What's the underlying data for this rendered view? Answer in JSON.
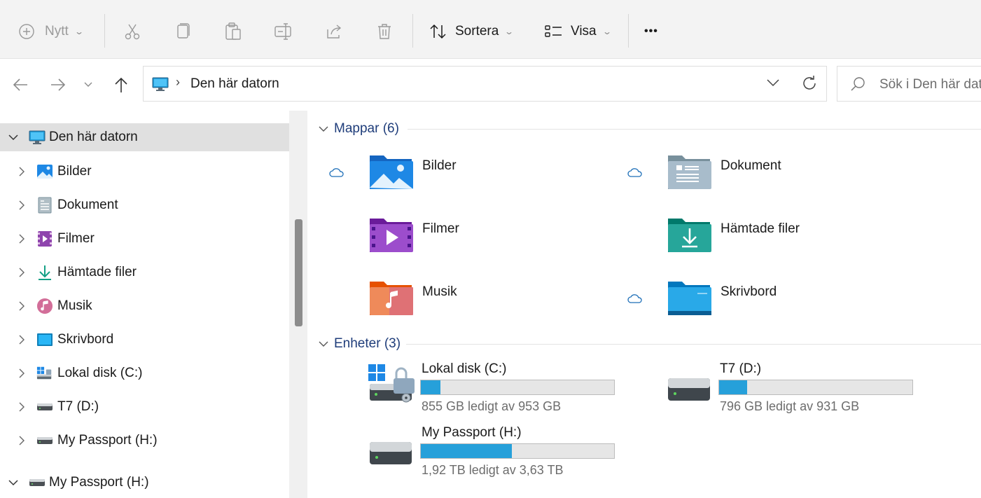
{
  "toolbar": {
    "new_label": "Nytt",
    "sort_label": "Sortera",
    "view_label": "Visa",
    "more_label": "•••"
  },
  "address": {
    "separator": "›",
    "current": "Den här datorn",
    "search_placeholder": "Sök i Den här datorn"
  },
  "sidebar": {
    "root": "Den här datorn",
    "items": [
      {
        "label": "Bilder",
        "icon": "pictures-icon"
      },
      {
        "label": "Dokument",
        "icon": "documents-icon"
      },
      {
        "label": "Filmer",
        "icon": "videos-icon"
      },
      {
        "label": "Hämtade filer",
        "icon": "downloads-icon"
      },
      {
        "label": "Musik",
        "icon": "music-icon"
      },
      {
        "label": "Skrivbord",
        "icon": "desktop-icon"
      },
      {
        "label": "Lokal disk (C:)",
        "icon": "system-drive-icon"
      },
      {
        "label": "T7 (D:)",
        "icon": "drive-icon"
      },
      {
        "label": "My Passport (H:)",
        "icon": "drive-icon"
      }
    ],
    "second_root": "My Passport (H:)"
  },
  "content": {
    "folders_header": "Mappar (6)",
    "folders": [
      {
        "label": "Bilder",
        "cloud": true
      },
      {
        "label": "Dokument",
        "cloud": true
      },
      {
        "label": "Filmer",
        "cloud": false
      },
      {
        "label": "Hämtade filer",
        "cloud": false
      },
      {
        "label": "Musik",
        "cloud": false
      },
      {
        "label": "Skrivbord",
        "cloud": true
      }
    ],
    "devices_header": "Enheter (3)",
    "drives": [
      {
        "label": "Lokal disk (C:)",
        "free_text": "855 GB ledigt av 953 GB",
        "used_fraction": 0.103
      },
      {
        "label": "T7 (D:)",
        "free_text": "796 GB ledigt av 931 GB",
        "used_fraction": 0.145
      },
      {
        "label": "My Passport (H:)",
        "free_text": "1,92 TB ledigt av 3,63 TB",
        "used_fraction": 0.471
      }
    ]
  },
  "colors": {
    "accent": "#26a0da",
    "group_header": "#1f3d7a",
    "cloud": "#1e6fb8"
  }
}
